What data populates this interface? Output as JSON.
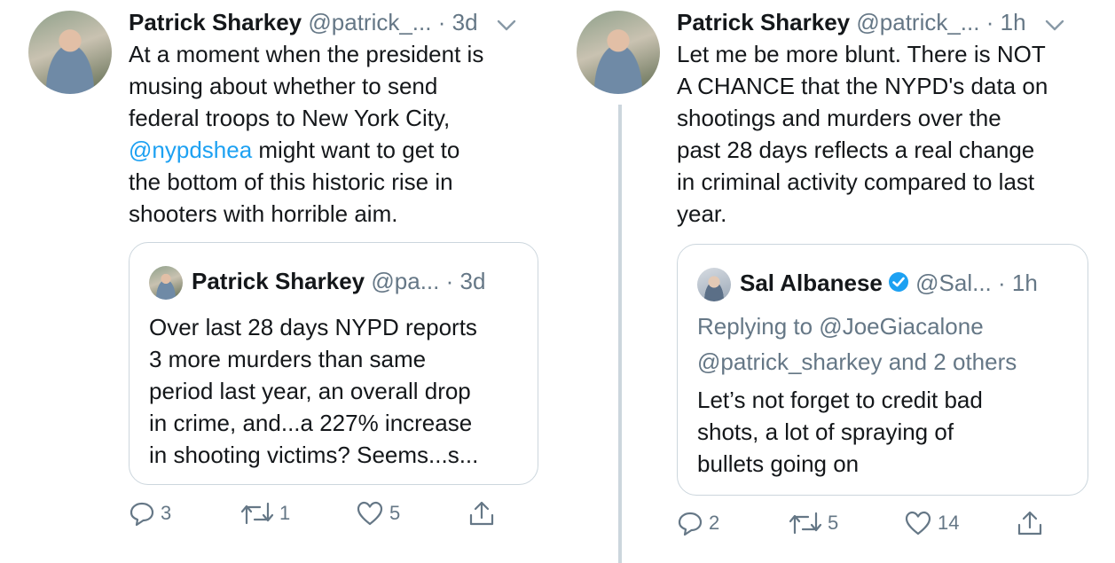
{
  "tweets": [
    {
      "author": "Patrick Sharkey",
      "handle": "@patrick_...",
      "dot": "·",
      "time": "3d",
      "text_before": "At a moment when the president is\nmusing about whether to send\nfederal troops to New York City,\n",
      "mention": "@nypdshea",
      "text_after": " might want to get to\nthe bottom of this historic rise in\nshooters with horrible aim.",
      "quote": {
        "author": "Patrick Sharkey",
        "handle": "@pa...",
        "dot": "·",
        "time": "3d",
        "text": "Over last 28 days NYPD reports\n3 more murders than same\nperiod last year, an overall drop\nin crime, and...a 227% increase\nin shooting victims? Seems...s..."
      },
      "actions": {
        "replies": "3",
        "retweets": "1",
        "likes": "5"
      }
    },
    {
      "author": "Patrick Sharkey",
      "handle": "@patrick_...",
      "dot": "·",
      "time": "1h",
      "text": "Let me be more blunt. There is NOT\nA CHANCE that the NYPD's data on\nshootings and murders over the\npast 28 days reflects a real change\nin criminal activity compared to last\nyear.",
      "quote": {
        "author": "Sal Albanese",
        "handle": "@Sal...",
        "dot": "·",
        "time": "1h",
        "replying": "Replying to @JoeGiacalone\n@patrick_sharkey and 2 others",
        "text": "Let’s not forget to credit bad\nshots, a lot of spraying of\nbullets going on"
      },
      "actions": {
        "replies": "2",
        "retweets": "5",
        "likes": "14"
      }
    }
  ],
  "colors": {
    "accent": "#1da1f2",
    "muted": "#657786",
    "border": "#ccd6dd",
    "text": "#14171a"
  },
  "icons": [
    "chevron-down-icon",
    "reply-icon",
    "retweet-icon",
    "like-icon",
    "share-icon",
    "verified-icon"
  ]
}
